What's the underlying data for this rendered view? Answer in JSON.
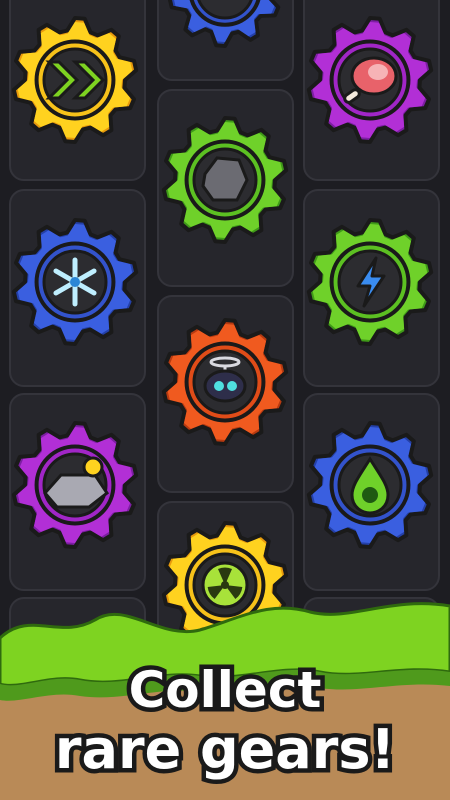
{
  "caption": {
    "line1": "Collect",
    "line2": "rare gears!"
  },
  "colors": {
    "background": "#1d1d22",
    "slot": "#2a2a30",
    "grass": "#7ed321",
    "dirt": "#b98a57",
    "gear_yellow": "#ffd21f",
    "gear_purple": "#b22fd6",
    "gear_green": "#6fd12a",
    "gear_blue": "#3a5fe0",
    "gear_orange": "#f05a1f"
  },
  "gears": [
    {
      "name": "top-partial-blue-gear",
      "color": "blue",
      "icon": "unknown-icon"
    },
    {
      "name": "speed-gear",
      "color": "yellow",
      "icon": "double-chevron-right-icon"
    },
    {
      "name": "meat-gear",
      "color": "purple",
      "icon": "ham-icon"
    },
    {
      "name": "rock-gear",
      "color": "green",
      "icon": "rock-icon"
    },
    {
      "name": "frost-gear",
      "color": "blue",
      "icon": "snowflake-icon"
    },
    {
      "name": "lightning-gear",
      "color": "green",
      "icon": "lightning-bolt-icon"
    },
    {
      "name": "drone-gear",
      "color": "orange",
      "icon": "drone-icon"
    },
    {
      "name": "metal-gear",
      "color": "purple",
      "icon": "metal-ingot-icon"
    },
    {
      "name": "poison-gear",
      "color": "blue",
      "icon": "poison-drop-skull-icon"
    },
    {
      "name": "radiation-gear",
      "color": "yellow",
      "icon": "radiation-icon"
    }
  ]
}
